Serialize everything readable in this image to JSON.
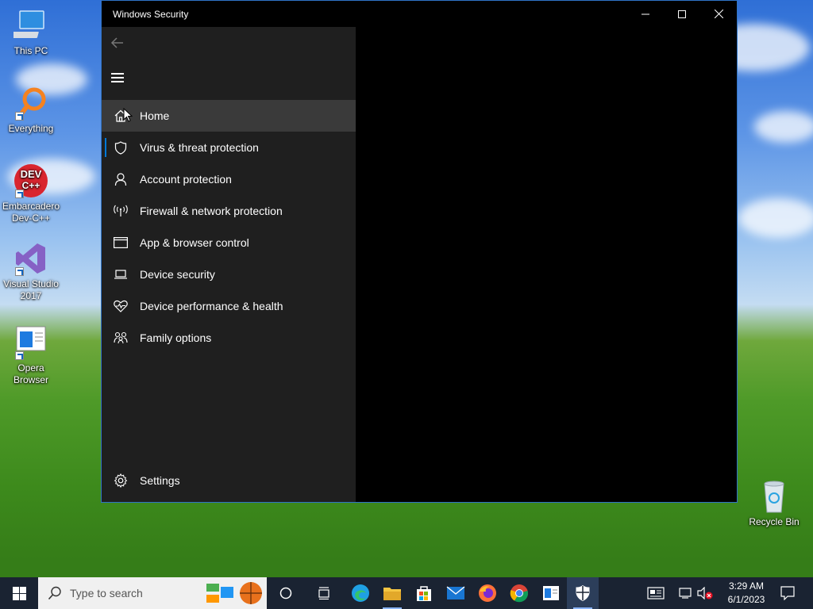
{
  "desktop": {
    "icons": [
      {
        "label": "This PC"
      },
      {
        "label": "Everything"
      },
      {
        "label": "Embarcadero Dev-C++"
      },
      {
        "label": "Visual Studio 2017"
      },
      {
        "label": "Opera Browser"
      },
      {
        "label": "Recycle Bin"
      }
    ],
    "devcpp_logo_line1": "DEV",
    "devcpp_logo_line2": "C++"
  },
  "window": {
    "title": "Windows Security",
    "sidebar": {
      "items": [
        {
          "label": "Home",
          "icon": "home-icon",
          "state": "hover"
        },
        {
          "label": "Virus & threat protection",
          "icon": "shield-icon",
          "state": "selected"
        },
        {
          "label": "Account protection",
          "icon": "person-icon"
        },
        {
          "label": "Firewall & network protection",
          "icon": "antenna-icon"
        },
        {
          "label": "App & browser control",
          "icon": "browser-window-icon"
        },
        {
          "label": "Device security",
          "icon": "laptop-icon"
        },
        {
          "label": "Device performance & health",
          "icon": "heart-pulse-icon"
        },
        {
          "label": "Family options",
          "icon": "family-icon"
        }
      ],
      "settings_label": "Settings"
    }
  },
  "taskbar": {
    "search_placeholder": "Type to search",
    "time": "3:29 AM",
    "date": "6/1/2023"
  },
  "colors": {
    "accent": "#0078d7",
    "sidebar_bg": "#1f1f1f",
    "hover_bg": "#3a3a3a",
    "taskbar_bg": "#1a2332"
  }
}
